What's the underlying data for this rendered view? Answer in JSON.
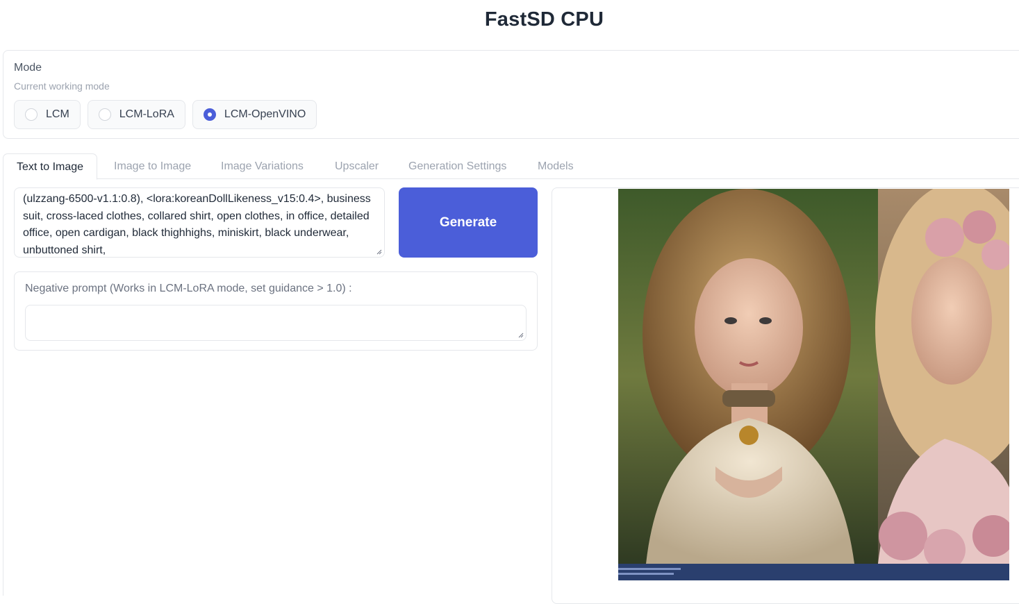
{
  "app": {
    "title": "FastSD CPU"
  },
  "mode": {
    "label": "Mode",
    "info": "Current working mode",
    "options": [
      {
        "label": "LCM",
        "checked": false
      },
      {
        "label": "LCM-LoRA",
        "checked": false
      },
      {
        "label": "LCM-OpenVINO",
        "checked": true
      }
    ]
  },
  "tabs": [
    {
      "label": "Text to Image",
      "active": true
    },
    {
      "label": "Image to Image",
      "active": false
    },
    {
      "label": "Image Variations",
      "active": false
    },
    {
      "label": "Upscaler",
      "active": false
    },
    {
      "label": "Generation Settings",
      "active": false
    },
    {
      "label": "Models",
      "active": false
    }
  ],
  "text_to_image": {
    "prompt_value": "(ulzzang-6500-v1.1:0.8), <lora:koreanDollLikeness_v15:0.4>, business suit, cross-laced clothes, collared shirt, open clothes, in office, detailed office, open cardigan, black thighhighs, miniskirt, black underwear, unbuttoned shirt,",
    "generate_label": "Generate",
    "negative_prompt_label": "Negative prompt (Works in LCM-LoRA mode, set guidance > 1.0) :",
    "negative_prompt_value": ""
  },
  "colors": {
    "accent": "#4b5ed9",
    "border": "#e5e7eb",
    "muted_text": "#9ca3af"
  },
  "icons": {
    "resize": "resize-grip-icon",
    "radio": "radio-icon"
  }
}
